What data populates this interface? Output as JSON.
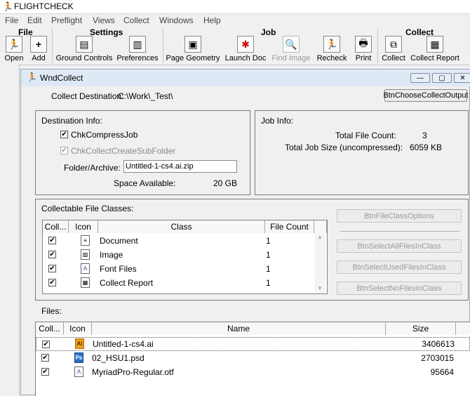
{
  "app": {
    "title": "FLIGHTCHECK"
  },
  "menubar": [
    "File",
    "Edit",
    "Preflight",
    "Views",
    "Collect",
    "Windows",
    "Help"
  ],
  "toolbar": {
    "groups": {
      "file": "File",
      "settings": "Settings",
      "job": "Job",
      "collect": "Collect"
    },
    "buttons": {
      "open": "Open",
      "add": "Add",
      "ground_controls": "Ground Controls",
      "preferences": "Preferences",
      "page_geometry": "Page Geometry",
      "launch_doc": "Launch Doc",
      "find_image": "Find Image",
      "recheck": "Recheck",
      "print": "Print",
      "collect": "Collect",
      "collect_report": "Collect Report"
    }
  },
  "window": {
    "title": "WndCollect",
    "collect_destination_label": "Collect Destination:",
    "collect_destination_value": "C:\\Work\\_Test\\",
    "choose_button": "BtnChooseCollectOutput"
  },
  "destination": {
    "title": "Destination Info:",
    "compress_label": "ChkCompressJob",
    "compress_checked": true,
    "subfolder_label": "ChkCollectCreateSubFolder",
    "subfolder_checked": true,
    "folder_label": "Folder/Archive:",
    "folder_value": "Untitled-1-cs4.ai.zip",
    "space_label": "Space Available:",
    "space_value": "20 GB"
  },
  "jobinfo": {
    "title": "Job Info:",
    "count_label": "Total File Count:",
    "count_value": "3",
    "size_label": "Total Job Size (uncompressed):",
    "size_value": "6059 KB"
  },
  "classes": {
    "title": "Collectable File Classes:",
    "headers": {
      "coll": "Coll...",
      "icon": "Icon",
      "class": "Class",
      "count": "File Count"
    },
    "rows": [
      {
        "name": "Document",
        "count": "1",
        "icon": "document-icon"
      },
      {
        "name": "Image",
        "count": "1",
        "icon": "image-icon"
      },
      {
        "name": "Font Files",
        "count": "1",
        "icon": "font-icon"
      },
      {
        "name": "Collect Report",
        "count": "1",
        "icon": "report-icon"
      }
    ],
    "buttons": {
      "options": "BtnFileClassOptions",
      "all": "BtnSelectAllFilesInClass",
      "used": "BtnSelectUsedFilesInClass",
      "none": "BtnSelectNoFilesInClass"
    }
  },
  "files": {
    "title": "Files:",
    "headers": {
      "coll": "Coll...",
      "icon": "Icon",
      "name": "Name",
      "size": "Size"
    },
    "rows": [
      {
        "name": "Untitled-1-cs4.ai",
        "size": "3406613",
        "icon": "ai-file-icon",
        "badge": "Ai"
      },
      {
        "name": "02_HSU1.psd",
        "size": "2703015",
        "icon": "psd-file-icon",
        "badge": "Ps"
      },
      {
        "name": "MyriadPro-Regular.otf",
        "size": "95664",
        "icon": "otf-file-icon",
        "badge": "A"
      }
    ]
  },
  "colors": {
    "accent": "#316ac5",
    "ai_orange": "#f0a020",
    "ps_blue": "#2a6fc9"
  }
}
